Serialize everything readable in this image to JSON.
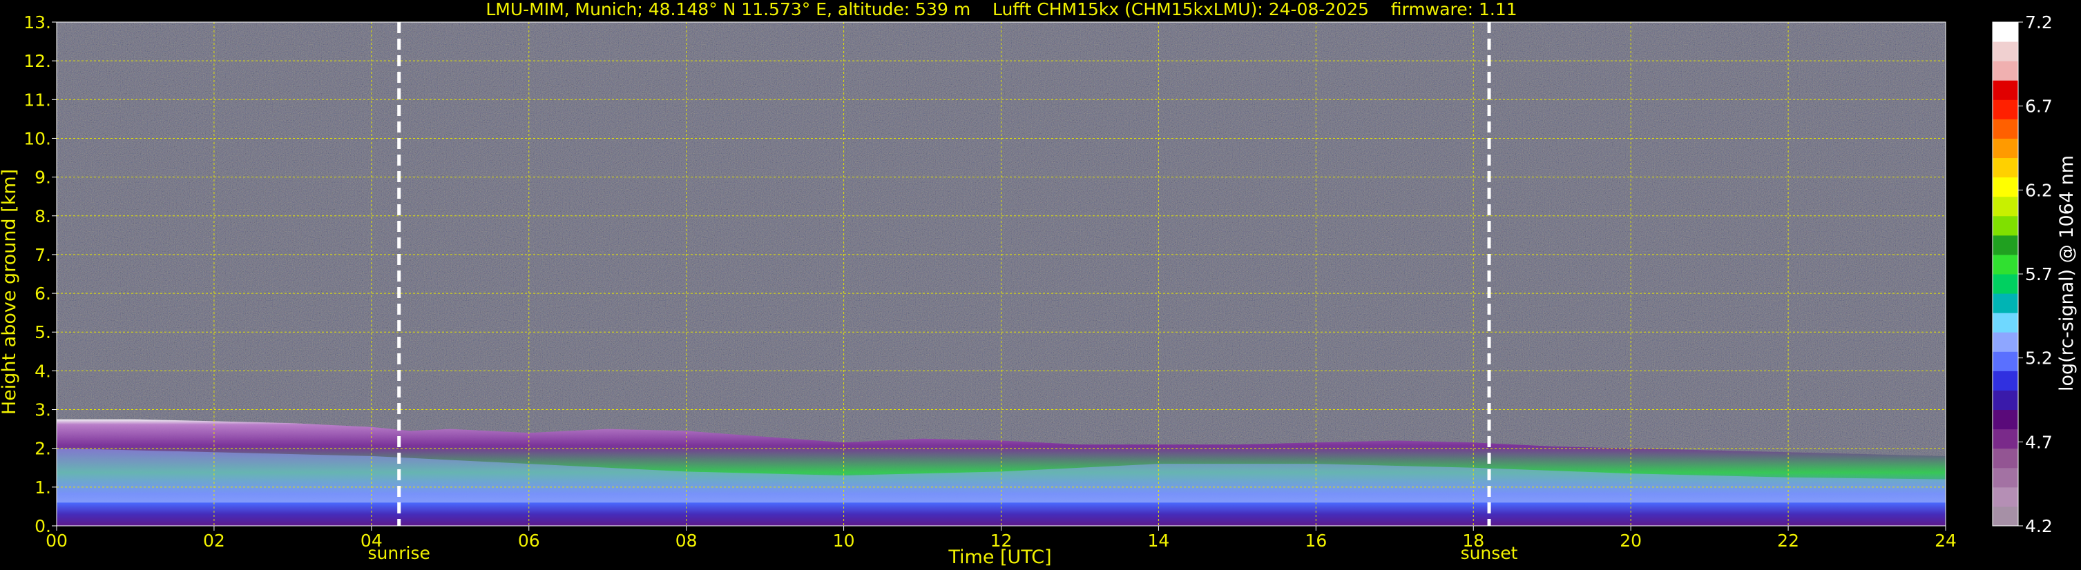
{
  "chart_data": {
    "type": "heatmap",
    "title": "LMU-MIM, Munich; 48.148° N 11.573° E, altitude: 539 m    Lufft CHM15kx (CHM15kxLMU): 24-08-2025    firmware: 1.11",
    "xlabel": "Time [UTC]",
    "ylabel": "Height above ground [km]",
    "xlim": [
      0,
      24
    ],
    "ylim": [
      0,
      13
    ],
    "x_ticks": [
      "00",
      "02",
      "04",
      "06",
      "08",
      "10",
      "12",
      "14",
      "16",
      "18",
      "20",
      "22",
      "24"
    ],
    "y_ticks": [
      "0.",
      "1.",
      "2.",
      "3.",
      "4.",
      "5.",
      "6.",
      "7.",
      "8.",
      "9.",
      "10.",
      "11.",
      "12.",
      "13."
    ],
    "grid": true,
    "annotations": [
      {
        "label": "sunrise",
        "x": 4.35
      },
      {
        "label": "sunset",
        "x": 18.2
      }
    ],
    "colorbar": {
      "label": "log(rc-signal) @ 1064 nm",
      "range": [
        4.2,
        7.2
      ],
      "ticks": [
        "7.2",
        "6.7",
        "6.2",
        "5.7",
        "5.2",
        "4.7",
        "4.2"
      ],
      "colors": [
        "#a690a6",
        "#b58fb5",
        "#a372a3",
        "#935593",
        "#7a2a8a",
        "#5a0a7a",
        "#3a1aaa",
        "#3030e0",
        "#5a70ff",
        "#8ea6ff",
        "#6fd8ff",
        "#00b4b4",
        "#00d060",
        "#30e030",
        "#20a020",
        "#80e000",
        "#c8f000",
        "#ffff00",
        "#ffd000",
        "#ff9a00",
        "#ff6000",
        "#ff2000",
        "#e00000",
        "#f0b0b0",
        "#f0d0d0",
        "#ffffff"
      ]
    },
    "layers": {
      "boundary_layer_top_km": [
        [
          0,
          2.75
        ],
        [
          1,
          2.75
        ],
        [
          2,
          2.7
        ],
        [
          3,
          2.65
        ],
        [
          4,
          2.55
        ],
        [
          4.5,
          2.45
        ],
        [
          5,
          2.5
        ],
        [
          6,
          2.4
        ],
        [
          7,
          2.5
        ],
        [
          8,
          2.45
        ],
        [
          9,
          2.3
        ],
        [
          10,
          2.15
        ],
        [
          11,
          2.25
        ],
        [
          12,
          2.2
        ],
        [
          13,
          2.1
        ],
        [
          14,
          2.1
        ],
        [
          15,
          2.1
        ],
        [
          16,
          2.15
        ],
        [
          17,
          2.2
        ],
        [
          18,
          2.15
        ],
        [
          19,
          2.05
        ],
        [
          20,
          2.0
        ],
        [
          21,
          1.95
        ],
        [
          22,
          1.9
        ],
        [
          23,
          1.85
        ],
        [
          24,
          1.8
        ]
      ],
      "aerosol_layer_top_km": [
        [
          0,
          2.0
        ],
        [
          2,
          1.9
        ],
        [
          4,
          1.8
        ],
        [
          6,
          1.6
        ],
        [
          8,
          1.4
        ],
        [
          10,
          1.3
        ],
        [
          12,
          1.4
        ],
        [
          14,
          1.6
        ],
        [
          16,
          1.6
        ],
        [
          18,
          1.5
        ],
        [
          20,
          1.35
        ],
        [
          22,
          1.25
        ],
        [
          24,
          1.2
        ]
      ]
    }
  }
}
